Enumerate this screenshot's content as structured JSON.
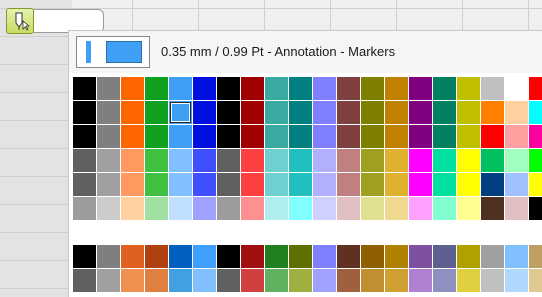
{
  "toolbar": {
    "tool_icon": "marker-pen-icon"
  },
  "popup": {
    "header": {
      "line_info": "0.35 mm / 0.99 Pt  -  Annotation - Markers"
    },
    "preview_color": "#3f9ff4",
    "palette_rows": [
      [
        "#000000",
        "#7f7f7f",
        "#ff6600",
        "#10a020",
        "#3f9ff4",
        "#0010e0",
        "#000000",
        "#a00000",
        "#3aaaa0",
        "#008080",
        "#8080ff",
        "#804040",
        "#808000",
        "#c08000",
        "#800080",
        "#008060",
        "#c0c000",
        "#c0c0c0",
        "#ffffff",
        "#ff0000"
      ],
      [
        "#000000",
        "#7f7f7f",
        "#ff6600",
        "#10a020",
        "#3f9ff4",
        "#0010e0",
        "#000000",
        "#a00000",
        "#3aaaa0",
        "#008080",
        "#8080ff",
        "#804040",
        "#808000",
        "#c08000",
        "#800080",
        "#008060",
        "#c0c000",
        "#ff8000",
        "#ffd0a0",
        "#00ffff"
      ],
      [
        "#000000",
        "#7f7f7f",
        "#ff6600",
        "#10a020",
        "#3f9ff4",
        "#0010e0",
        "#000000",
        "#a00000",
        "#3aaaa0",
        "#008080",
        "#8080ff",
        "#804040",
        "#808000",
        "#c08000",
        "#800080",
        "#008060",
        "#c0c000",
        "#ff0000",
        "#ffa0a0",
        "#ff00a0"
      ],
      [
        "#606060",
        "#a0a0a0",
        "#ff9960",
        "#40c040",
        "#80c0ff",
        "#4050ff",
        "#606060",
        "#ff4040",
        "#70d0d0",
        "#20c0c0",
        "#b0b0ff",
        "#c08080",
        "#a0a020",
        "#e0b030",
        "#ff00ff",
        "#00e0a0",
        "#ffff00",
        "#00c060",
        "#a0ffc0",
        "#00ff00"
      ],
      [
        "#606060",
        "#a0a0a0",
        "#ff9960",
        "#40c040",
        "#80c0ff",
        "#4050ff",
        "#606060",
        "#ff4040",
        "#70d0d0",
        "#20c0c0",
        "#b0b0ff",
        "#c08080",
        "#a0a020",
        "#e0b030",
        "#ff00ff",
        "#00e0a0",
        "#ffff00",
        "#004080",
        "#a0c0ff",
        "#ffff00"
      ],
      [
        "#9c9c9c",
        "#cccccc",
        "#ffd0a0",
        "#a0e0a0",
        "#c0e0ff",
        "#a0a0ff",
        "#9c9c9c",
        "#ff9090",
        "#b0eeee",
        "#80ffff",
        "#d0d0ff",
        "#e0c0c0",
        "#e0e090",
        "#f0d890",
        "#ffa0ff",
        "#80ffd0",
        "#ffff90",
        "#503020",
        "#e0c0c0",
        "#000000"
      ],
      [
        "#ffffff",
        "#ffffff",
        "#ffffff",
        "#ffffff",
        "#ffffff",
        "#ffffff",
        "#ffffff",
        "#ffffff",
        "#ffffff",
        "#ffffff",
        "#ffffff",
        "#ffffff",
        "#ffffff",
        "#ffffff",
        "#ffffff",
        "#ffffff",
        "#ffffff",
        "#ffffff",
        "#ffffff",
        "#ffffff"
      ],
      [
        "#000000",
        "#7f7f7f",
        "#e06020",
        "#b04010",
        "#0060c0",
        "#40a0ff",
        "#000000",
        "#a01010",
        "#208020",
        "#607000",
        "#8080ff",
        "#603020",
        "#906000",
        "#b08000",
        "#8050a0",
        "#606090",
        "#b0a000",
        "#a0a0a0",
        "#80c0ff",
        "#c0a060"
      ],
      [
        "#606060",
        "#a0a0a0",
        "#f09050",
        "#e08040",
        "#40a0e0",
        "#80c0ff",
        "#606060",
        "#d04040",
        "#60b060",
        "#a0b040",
        "#a0a0ff",
        "#a06040",
        "#c09030",
        "#d0a030",
        "#b080d0",
        "#9090c0",
        "#e0d040",
        "#c0c0c0",
        "#b0d8ff",
        "#e0c890"
      ]
    ]
  }
}
